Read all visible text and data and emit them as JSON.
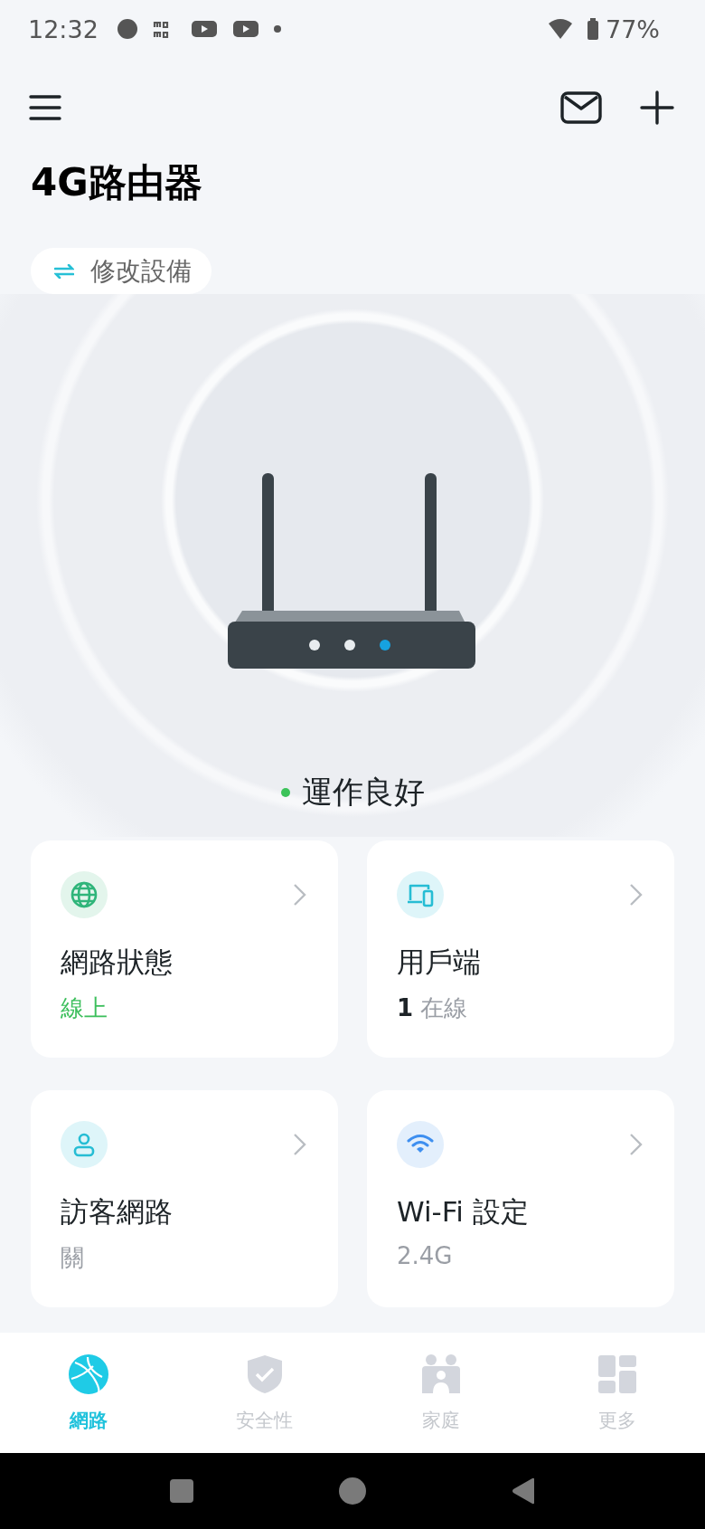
{
  "status_bar": {
    "time": "12:32",
    "battery": "77%"
  },
  "title": "4G路由器",
  "switch_device": {
    "label": "修改設備"
  },
  "device_status": {
    "text": "運作良好",
    "color": "#3cc35a"
  },
  "cards": [
    {
      "kind": "globe",
      "title": "網路狀態",
      "value": "線上",
      "color": "#3cbf5c"
    },
    {
      "kind": "devices",
      "title": "用戶端",
      "value": "**1** 在線",
      "color": "#9a9ea5"
    },
    {
      "kind": "guest",
      "title": "訪客網路",
      "value": "關",
      "color": "#9a9ea5"
    },
    {
      "kind": "wifi",
      "title": "Wi-Fi 設定",
      "value": "2.4G",
      "color": "#9a9ea5"
    }
  ],
  "tabs": [
    {
      "kind": "network",
      "label": "網路",
      "selected": true
    },
    {
      "kind": "security",
      "label": "安全性",
      "selected": false
    },
    {
      "kind": "family",
      "label": "家庭",
      "selected": false
    },
    {
      "kind": "more",
      "label": "更多",
      "selected": false
    }
  ]
}
